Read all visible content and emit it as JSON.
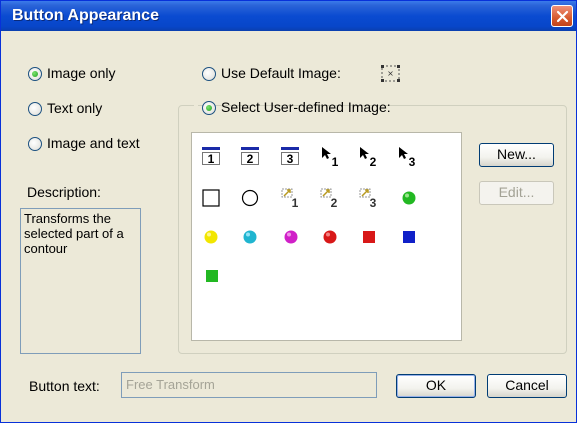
{
  "window": {
    "title": "Button Appearance"
  },
  "display_mode": {
    "options": [
      {
        "label": "Image only",
        "selected": true
      },
      {
        "label": "Text only",
        "selected": false
      },
      {
        "label": "Image and text",
        "selected": false
      }
    ]
  },
  "image_source": {
    "default_label": "Use Default Image:",
    "default_selected": false,
    "user_label": "Select User-defined Image:",
    "user_selected": true
  },
  "image_grid": {
    "row1": [
      {
        "icon": "numbered-1-icon",
        "text": "1"
      },
      {
        "icon": "numbered-2-icon",
        "text": "2"
      },
      {
        "icon": "numbered-3-icon",
        "text": "3"
      },
      {
        "icon": "arrow-1-icon",
        "sub": "1"
      },
      {
        "icon": "arrow-2-icon",
        "sub": "2"
      },
      {
        "icon": "arrow-3-icon",
        "sub": "3"
      }
    ],
    "row2_subs": [
      "1",
      "2",
      "3"
    ],
    "colors": {
      "green": "#22b822",
      "yellow": "#f2e600",
      "cyan": "#20b5d0",
      "magenta": "#d020c8",
      "red": "#d81818",
      "blue": "#1020c8"
    }
  },
  "buttons": {
    "new": "New...",
    "edit": "Edit...",
    "ok": "OK",
    "cancel": "Cancel"
  },
  "description": {
    "label": "Description:",
    "text": "Transforms the selected part of a contour"
  },
  "button_text": {
    "label": "Button text:",
    "value": "Free Transform"
  }
}
